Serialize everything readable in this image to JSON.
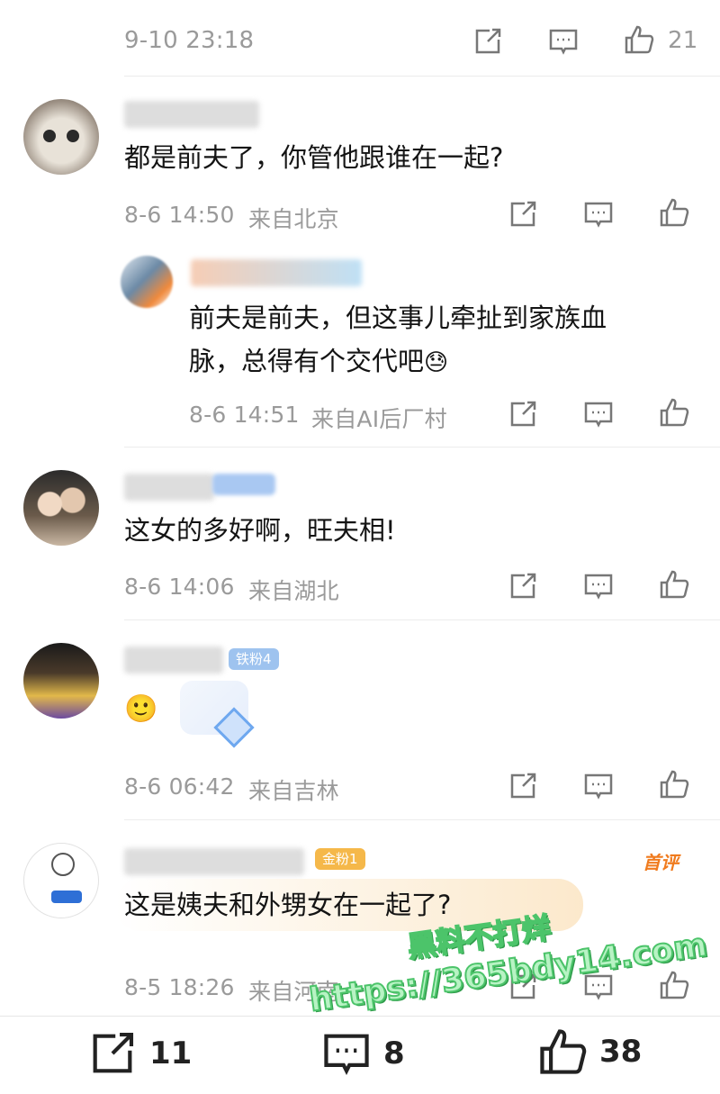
{
  "top": {
    "timestamp": "9-10 23:18",
    "like_count": "21"
  },
  "comments": [
    {
      "text": "都是前夫了，你管他跟谁在一起?",
      "time": "8-6 14:50",
      "location": "来自北京"
    },
    {
      "text_line1": "前夫是前夫，但这事儿牵扯到家族血",
      "text_line2": "脉，总得有个交代吧",
      "emoji": "😓",
      "time": "8-6 14:51",
      "location": "来自AI后厂村"
    },
    {
      "text": "这女的多好啊，旺夫相!",
      "time": "8-6 14:06",
      "location": "来自湖北"
    },
    {
      "emoji": "🙂",
      "badge": "铁粉4",
      "time": "8-6 06:42",
      "location": "来自吉林"
    },
    {
      "text": "这是姨夫和外甥女在一起了?",
      "badge": "金粉1",
      "tag": "首评",
      "time": "8-5 18:26",
      "location": "来自河南"
    }
  ],
  "bottom_bar": {
    "share_count": "11",
    "comment_count": "8",
    "like_count": "38"
  },
  "watermark": {
    "line1": "黑料不打烊",
    "line2": "https://365bdy14.com"
  },
  "icons": [
    "share-icon",
    "comment-icon",
    "like-icon"
  ]
}
